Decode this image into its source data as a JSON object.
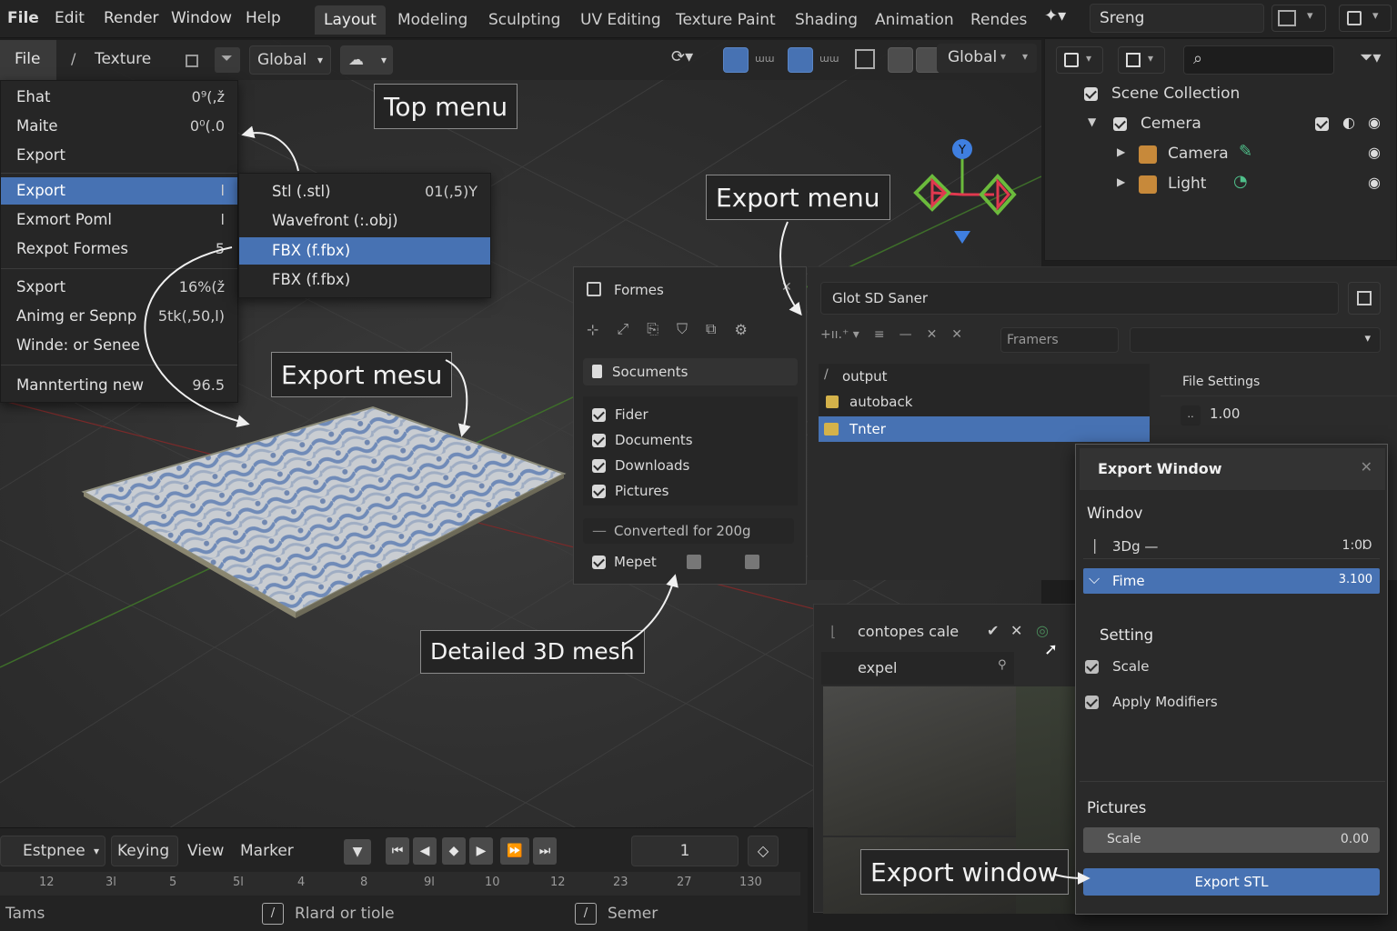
{
  "topbar": {
    "menus": [
      "File",
      "Edit",
      "Render",
      "Window",
      "Help"
    ],
    "workspaces": [
      "Layout",
      "Modeling",
      "Sculpting",
      "UV Editing",
      "Texture Paint",
      "Shading",
      "Animation",
      "Rendes"
    ],
    "scene_name": "Sreng"
  },
  "vp_header": {
    "file_label": "File",
    "texture_label": "Texture",
    "orientation": "Global",
    "right_orientation": "Global"
  },
  "file_menu": {
    "items": [
      {
        "label": "Ehat",
        "shortcut": "0⁹(,ž"
      },
      {
        "label": "Maite",
        "shortcut": "0⁰(.0"
      },
      {
        "label": "Export",
        "shortcut": ""
      },
      {
        "label": "Export",
        "shortcut": "l"
      },
      {
        "label": "Exmort Poml",
        "shortcut": "l"
      },
      {
        "label": "Rexpot Formes",
        "shortcut": "5"
      },
      {
        "label": "Sxport",
        "shortcut": "16%(ž"
      },
      {
        "label": "Animg er Sepnp",
        "shortcut": "5tk(,50,l)"
      },
      {
        "label": "Winde: or Senee",
        "shortcut": ""
      },
      {
        "label": "Mannterting new",
        "shortcut": "96.5"
      }
    ]
  },
  "export_submenu": {
    "items": [
      {
        "label": "Stl (.stl)",
        "shortcut": "01(,5)Y"
      },
      {
        "label": "Wavefront (:.obj)",
        "shortcut": ""
      },
      {
        "label": "FBX (f.fbx)",
        "shortcut": ""
      },
      {
        "label": "FBX (f.fbx)",
        "shortcut": ""
      }
    ]
  },
  "callouts": {
    "top_menu": "Top menu",
    "export_menu": "Export menu",
    "export_mesu": "Export mesu",
    "detailed_mesh": "Detailed 3D mesh",
    "export_window": "Export window"
  },
  "gizmo": {
    "y_label": "Y"
  },
  "outliner": {
    "scene_collection": "Scene Collection",
    "collection": "Cemera",
    "camera": "Camera",
    "light": "Light"
  },
  "formes_panel": {
    "title": "Formes",
    "section": "Socuments",
    "items": [
      "Fider",
      "Documents",
      "Downloads",
      "Pictures"
    ],
    "converted": "Convertedl for 200g",
    "mepet": "Mepet"
  },
  "file_browser": {
    "path": "Glot SD Saner",
    "filter_placeholder": "Framers",
    "files": [
      "output",
      "autoback",
      "Tnter"
    ],
    "file_settings": "File Settings",
    "settings_value": "1.00",
    "sub_title": "contopes cale",
    "sub_item": "expel"
  },
  "export_window": {
    "title": "Export Window",
    "window_label": "Windov",
    "row1_label": "3Dg —",
    "row1_value": "1:0Ɒ",
    "row2_label": "Fime",
    "row2_value": "3.100",
    "setting_label": "Setting",
    "scale_label": "Scale",
    "apply_modifiers": "Apply Modifiers",
    "pictures_label": "Pictures",
    "pic_scale_label": "Scale",
    "pic_scale_value": "0.00",
    "export_button": "Export STL"
  },
  "timeline": {
    "mode": "Estpnee",
    "keying": "Keying",
    "view": "View",
    "marker": "Marker",
    "current_frame": "1",
    "ruler": [
      "12",
      "3l",
      "5",
      "5l",
      "4",
      "8",
      "9l",
      "10",
      "12",
      "23",
      "27",
      "130"
    ],
    "status_left": "Tams",
    "status_mid": "Rlard or tiole",
    "status_right": "Semer"
  },
  "colors": {
    "accent": "#4772b3",
    "panel_bg": "#2a2a2a",
    "header_bg": "#232323",
    "gizmo_red": "#e0394f",
    "gizmo_green": "#6bba3c",
    "gizmo_blue": "#3f7fe0"
  }
}
